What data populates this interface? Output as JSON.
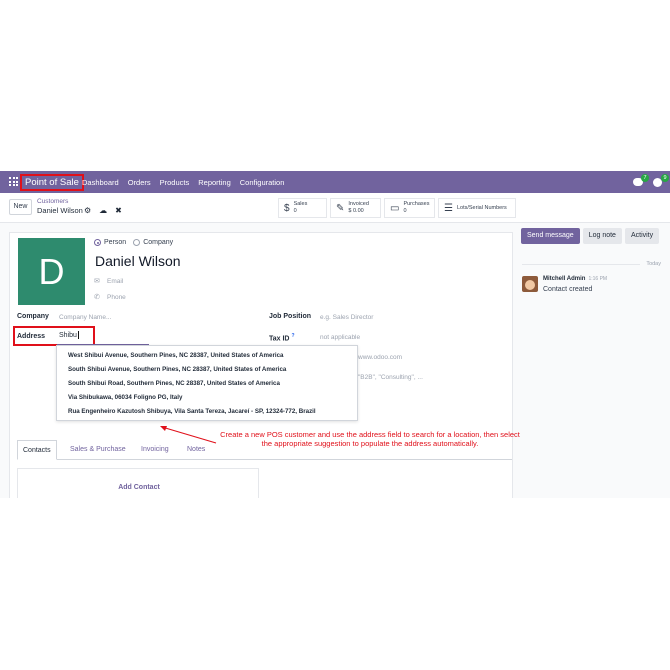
{
  "navbar": {
    "app_name": "Point of Sale",
    "menu": [
      "Dashboard",
      "Orders",
      "Products",
      "Reporting",
      "Configuration"
    ],
    "messages_count": "7",
    "activities_count": "9",
    "bg_color": "#71639e"
  },
  "controlbar": {
    "new_label": "New",
    "breadcrumb_parent": "Customers",
    "breadcrumb_current": "Daniel Wilson",
    "smart_buttons": {
      "sales": {
        "title": "Sales",
        "value": "0",
        "icon": "dollar-icon"
      },
      "invoiced": {
        "title": "Invoiced",
        "value": "$ 0.00",
        "icon": "edit-icon"
      },
      "purchases": {
        "title": "Purchases",
        "value": "0",
        "icon": "card-icon"
      },
      "lots": {
        "title": "Lots/Serial Numbers",
        "icon": "list-icon"
      }
    }
  },
  "form": {
    "avatar_letter": "D",
    "type_person": "Person",
    "type_company": "Company",
    "name": "Daniel Wilson",
    "email_placeholder": "Email",
    "phone_placeholder": "Phone",
    "company_label": "Company",
    "company_placeholder": "Company Name...",
    "address_label": "Address",
    "address_value": "Shibu",
    "job_position_label": "Job Position",
    "job_position_placeholder": "e.g. Sales Director",
    "tax_id_label": "Tax ID",
    "tax_id_placeholder": "not applicable",
    "website_partial": "www.odoo.com",
    "tags_partial": "\"B2B\", \"Consulting\", ..."
  },
  "address_suggestions": [
    "West Shibui Avenue, Southern Pines, NC 28387, United States of America",
    "South Shibui Avenue, Southern Pines, NC 28387, United States of America",
    "South Shibui Road, Southern Pines, NC 28387, United States of America",
    "Via Shibukawa, 06034 Foligno PG, Italy",
    "Rua Engenheiro Kazutosh Shibuya, Vila Santa Tereza, Jacareí - SP, 12324-772, Brazil"
  ],
  "tabs": [
    "Contacts",
    "Sales & Purchase",
    "Invoicing",
    "Notes"
  ],
  "add_contact_label": "Add Contact",
  "annotation": "Create a new POS customer and use the address field to search for a location, then select the appropriate suggestion to populate the address automatically.",
  "chatter": {
    "send_message": "Send message",
    "log_note": "Log note",
    "activity": "Activity",
    "today": "Today",
    "author": "Mitchell Admin",
    "time": "1:16 PM",
    "message": "Contact created"
  }
}
